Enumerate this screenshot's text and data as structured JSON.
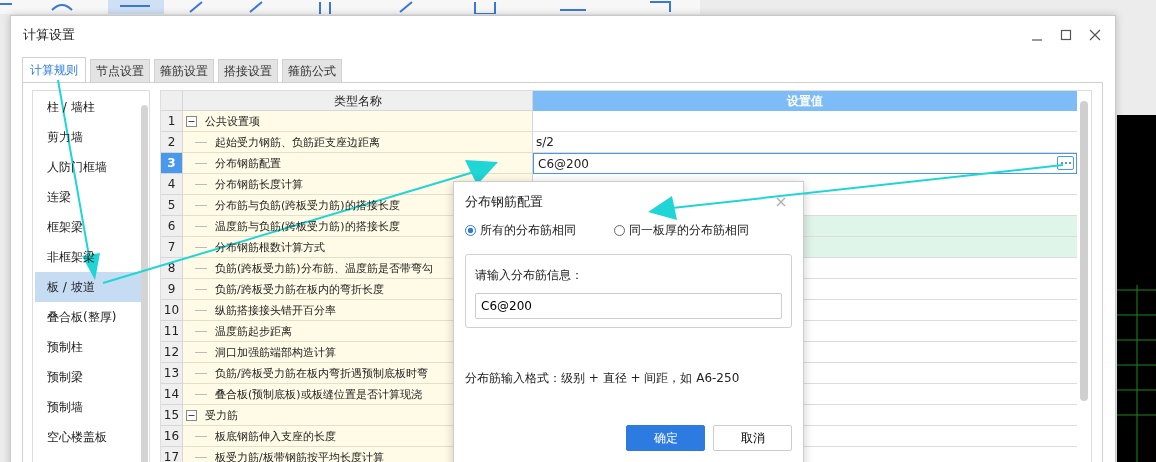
{
  "window": {
    "title": "计算设置"
  },
  "tabs": [
    {
      "label": "计算规则",
      "selected": true
    },
    {
      "label": "节点设置",
      "selected": false
    },
    {
      "label": "箍筋设置",
      "selected": false
    },
    {
      "label": "搭接设置",
      "selected": false
    },
    {
      "label": "箍筋公式",
      "selected": false
    }
  ],
  "sidebar": {
    "items": [
      {
        "label": "柱 / 墙柱",
        "selected": false
      },
      {
        "label": "剪力墙",
        "selected": false
      },
      {
        "label": "人防门框墙",
        "selected": false
      },
      {
        "label": "连梁",
        "selected": false
      },
      {
        "label": "框架梁",
        "selected": false
      },
      {
        "label": "非框架梁",
        "selected": false
      },
      {
        "label": "板 / 坡道",
        "selected": true
      },
      {
        "label": "叠合板(整厚)",
        "selected": false
      },
      {
        "label": "预制柱",
        "selected": false
      },
      {
        "label": "预制梁",
        "selected": false
      },
      {
        "label": "预制墙",
        "selected": false
      },
      {
        "label": "空心楼盖板",
        "selected": false
      }
    ]
  },
  "table": {
    "columns": [
      "类型名称",
      "设置值"
    ],
    "rows": [
      {
        "number": "1",
        "kind": "group",
        "name": "公共设置项",
        "expanded": true,
        "selected": false,
        "highlighted": false
      },
      {
        "number": "2",
        "kind": "item",
        "name": "起始受力钢筋、负筋距支座边距离",
        "value": "s/2",
        "selected": false,
        "highlighted": false
      },
      {
        "number": "3",
        "kind": "item",
        "name": "分布钢筋配置",
        "value": "C6@200",
        "selected": true,
        "highlighted": false
      },
      {
        "number": "4",
        "kind": "item",
        "name": "分布钢筋长度计算",
        "selected": false,
        "highlighted": false
      },
      {
        "number": "5",
        "kind": "item",
        "name": "分布筋与负筋(跨板受力筋)的搭接长度",
        "selected": false,
        "highlighted": false
      },
      {
        "number": "6",
        "kind": "item",
        "name": "温度筋与负筋(跨板受力筋)的搭接长度",
        "selected": false,
        "highlighted": true
      },
      {
        "number": "7",
        "kind": "item",
        "name": "分布钢筋根数计算方式",
        "selected": false,
        "highlighted": true
      },
      {
        "number": "8",
        "kind": "item",
        "name": "负筋(跨板受力筋)分布筋、温度筋是否带弯勾",
        "selected": false,
        "highlighted": false
      },
      {
        "number": "9",
        "kind": "item",
        "name": "负筋/跨板受力筋在板内的弯折长度",
        "selected": false,
        "highlighted": false
      },
      {
        "number": "10",
        "kind": "item",
        "name": "纵筋搭接接头错开百分率",
        "selected": false,
        "highlighted": false
      },
      {
        "number": "11",
        "kind": "item",
        "name": "温度筋起步距离",
        "selected": false,
        "highlighted": false
      },
      {
        "number": "12",
        "kind": "item",
        "name": "洞口加强筋端部构造计算",
        "selected": false,
        "highlighted": false
      },
      {
        "number": "13",
        "kind": "item",
        "name": "负筋/跨板受力筋在板内弯折遇预制底板时弯",
        "selected": false,
        "highlighted": false
      },
      {
        "number": "14",
        "kind": "item",
        "name": "叠合板(预制底板)或板缝位置是否计算现浇",
        "selected": false,
        "highlighted": false
      },
      {
        "number": "15",
        "kind": "group",
        "name": "受力筋",
        "expanded": true,
        "selected": false,
        "highlighted": false
      },
      {
        "number": "16",
        "kind": "item",
        "name": "板底钢筋伸入支座的长度",
        "selected": false,
        "highlighted": false
      },
      {
        "number": "17",
        "kind": "item",
        "name": "板受力筋/板带钢筋按平均长度计算",
        "selected": false,
        "highlighted": false
      }
    ]
  },
  "dialog": {
    "title": "分布钢筋配置",
    "options": [
      {
        "label": "所有的分布筋相同",
        "selected": true
      },
      {
        "label": "同一板厚的分布筋相同",
        "selected": false
      }
    ],
    "field_label": "请输入分布筋信息：",
    "field_value": "C6@200",
    "hint": "分布筋输入格式：级别 + 直径 + 间距，如 A6-250",
    "buttons": [
      {
        "label": "确定",
        "kind": "primary"
      },
      {
        "label": "取消",
        "kind": "secondary"
      }
    ]
  }
}
